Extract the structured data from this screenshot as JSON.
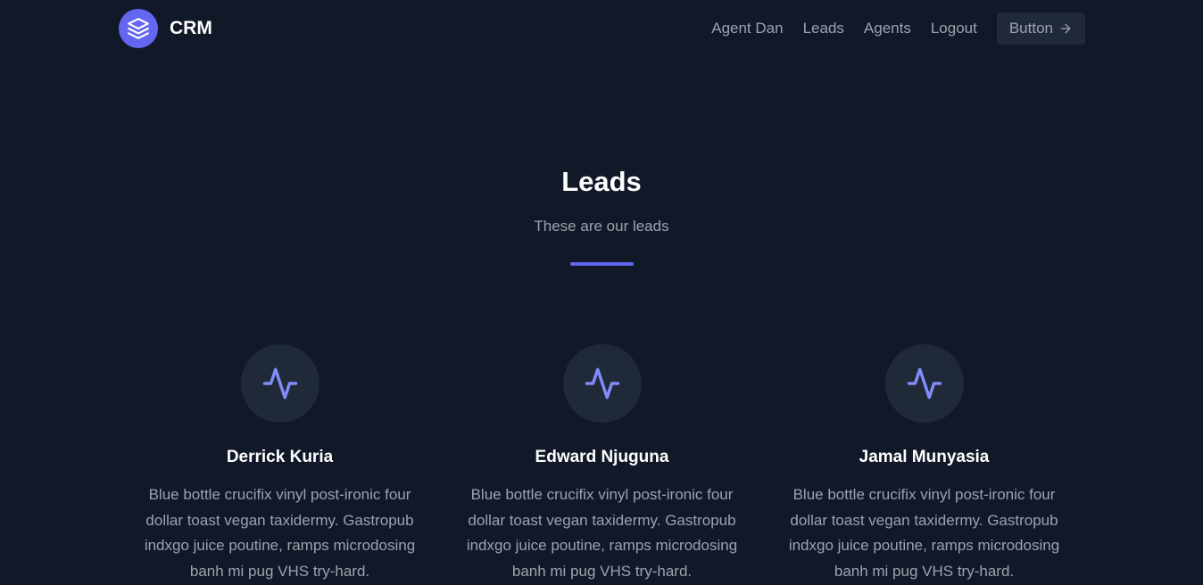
{
  "header": {
    "brand_name": "CRM",
    "brand_icon": "stack-layers-icon",
    "nav": [
      {
        "label": "Agent Dan"
      },
      {
        "label": "Leads"
      },
      {
        "label": "Agents"
      },
      {
        "label": "Logout"
      }
    ],
    "button_label": "Button",
    "button_icon": "arrow-right-icon"
  },
  "hero": {
    "title": "Leads",
    "subtitle": "These are our leads"
  },
  "leads": [
    {
      "name": "Derrick Kuria",
      "icon": "activity-icon",
      "description": "Blue bottle crucifix vinyl post-ironic four dollar toast vegan taxidermy. Gastropub indxgo juice poutine, ramps microdosing banh mi pug VHS try-hard."
    },
    {
      "name": "Edward Njuguna",
      "icon": "activity-icon",
      "description": "Blue bottle crucifix vinyl post-ironic four dollar toast vegan taxidermy. Gastropub indxgo juice poutine, ramps microdosing banh mi pug VHS try-hard."
    },
    {
      "name": "Jamal Munyasia",
      "icon": "activity-icon",
      "description": "Blue bottle crucifix vinyl post-ironic four dollar toast vegan taxidermy. Gastropub indxgo juice poutine, ramps microdosing banh mi pug VHS try-hard."
    }
  ],
  "colors": {
    "background": "#111827",
    "accent": "#6366f1",
    "icon_accent": "#818cf8",
    "muted_text": "#9ca3af",
    "surface": "#1f2937"
  }
}
